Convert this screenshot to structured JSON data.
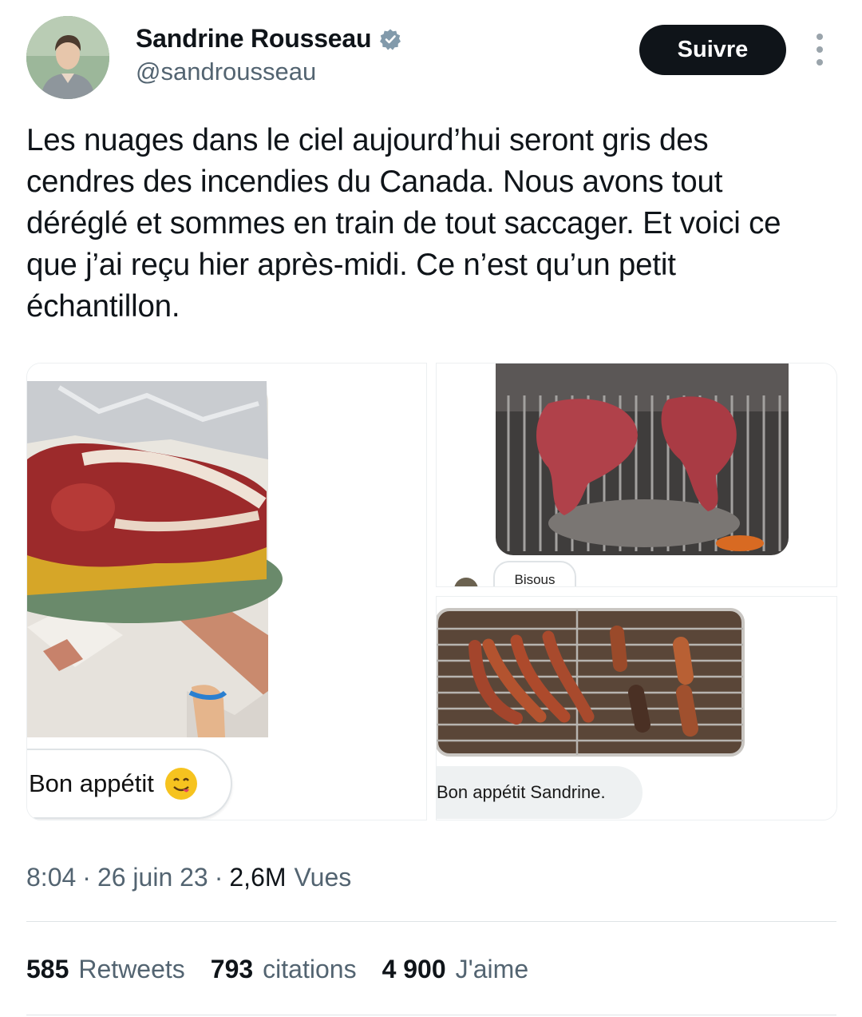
{
  "author": {
    "name": "Sandrine Rousseau",
    "handle": "@sandrousseau",
    "verified_icon": "verified-badge-icon"
  },
  "actions": {
    "follow_label": "Suivre",
    "more_icon": "more-vertical-icon"
  },
  "tweet": {
    "text": "Les nuages dans le ciel aujourd’hui seront gris des cendres des incendies du Canada. Nous avons tout déréglé et sommes en train de tout saccager. Et voici ce que j’ai reçu hier après-midi. Ce n’est qu’un petit échantillon."
  },
  "media": {
    "image1_caption": "Bon appétit",
    "image2_caption": "Bisous",
    "image3_caption": "Bon appétit Sandrine."
  },
  "meta": {
    "time": "8:04",
    "date": "26 juin 23",
    "views_count": "2,6M",
    "views_label": "Vues",
    "separator": "·"
  },
  "stats": {
    "retweets_count": "585",
    "retweets_label": "Retweets",
    "quotes_count": "793",
    "quotes_label": "citations",
    "likes_count": "4 900",
    "likes_label": "J'aime"
  },
  "colors": {
    "text_primary": "#0f1419",
    "text_secondary": "#536471",
    "follow_bg": "#0f1419",
    "verified": "#829aab",
    "divider": "#dfe3e6"
  }
}
